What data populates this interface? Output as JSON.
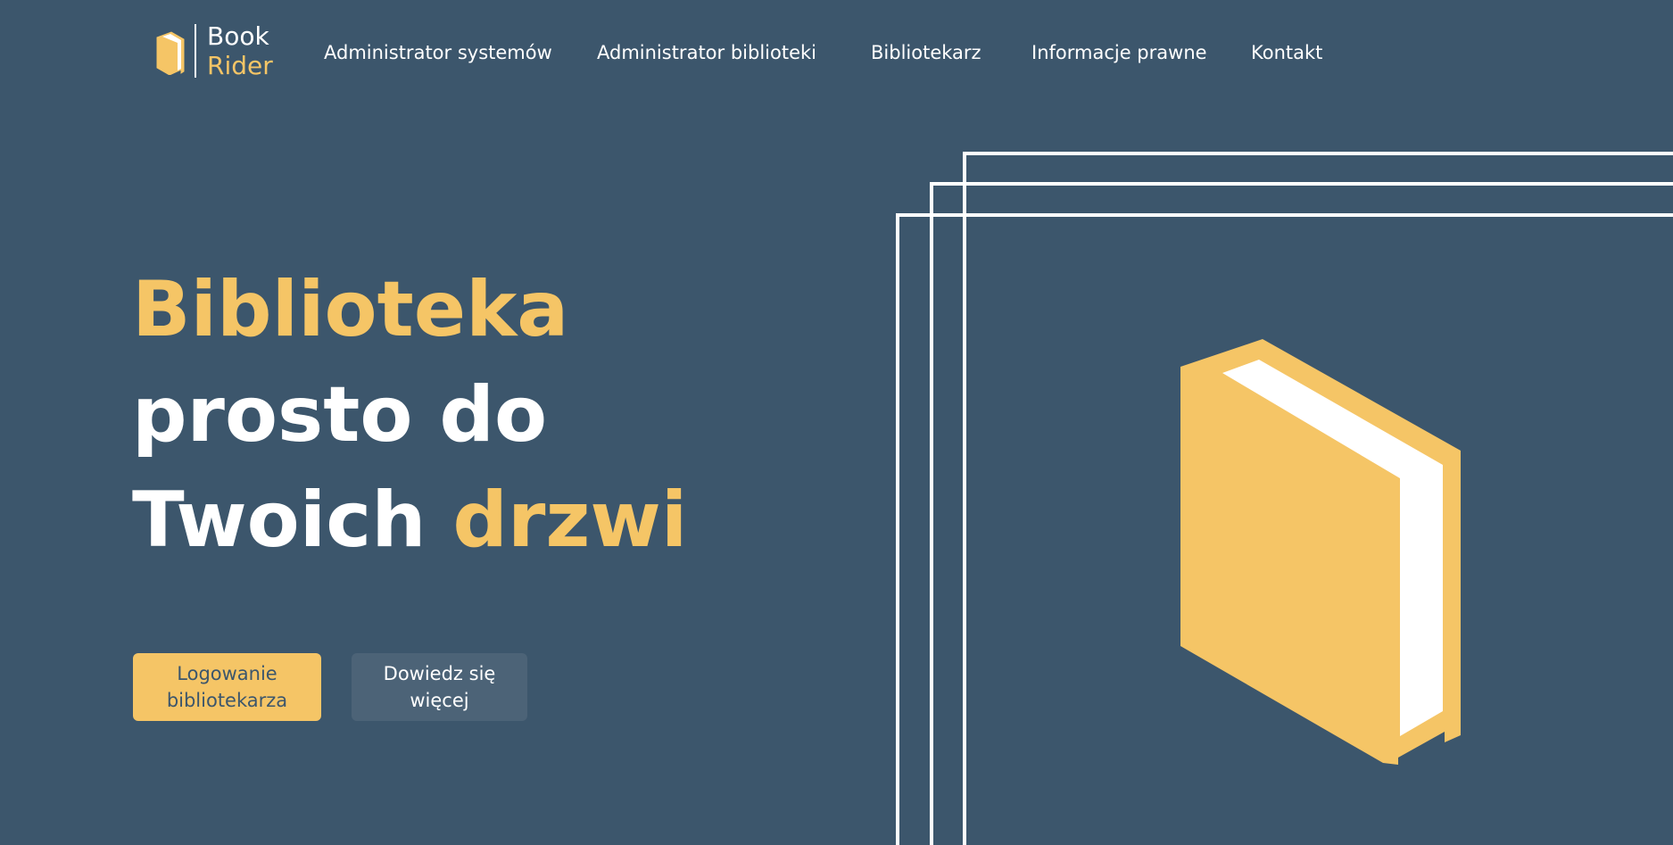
{
  "brand": {
    "name_line1": "Book",
    "name_line2": "Rider",
    "logo_icon": "book-icon"
  },
  "nav": {
    "items": [
      {
        "label": "Administrator systemów"
      },
      {
        "label": "Administrator biblioteki"
      },
      {
        "label": "Bibliotekarz"
      },
      {
        "label": "Informacje prawne"
      },
      {
        "label": "Kontakt"
      }
    ]
  },
  "hero": {
    "title_part1": "Biblioteka",
    "title_part2": "prosto do",
    "title_part3": "Twoich",
    "title_part4": "drzwi",
    "primary_button": "Logowanie bibliotekarza",
    "secondary_button": "Dowiedz się więcej",
    "illustration_icon": "book-icon"
  },
  "colors": {
    "background": "#3c566c",
    "accent": "#f5c566",
    "secondary_button_bg": "#4c6377",
    "text": "#ffffff"
  }
}
